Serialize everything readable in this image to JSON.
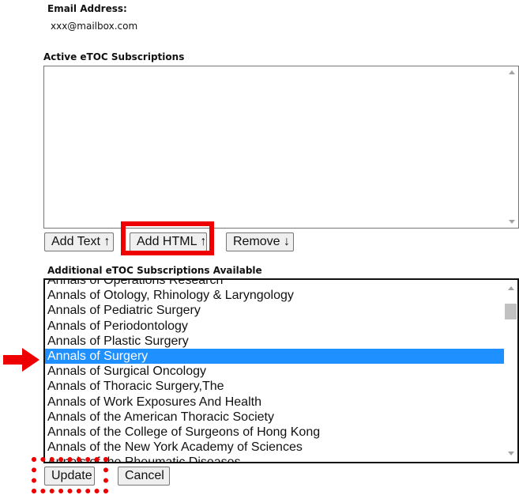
{
  "email": {
    "label": "Email Address:",
    "value": "xxx@mailbox.com"
  },
  "active": {
    "label": "Active eTOC Subscriptions",
    "items": []
  },
  "buttons": {
    "add_text": "Add Text ↑",
    "add_html": "Add HTML ↑",
    "remove": "Remove ↓",
    "update": "Update",
    "cancel": "Cancel"
  },
  "available": {
    "label": "Additional eTOC Subscriptions Available",
    "selected": "Annals of Surgery",
    "items": [
      "Annals of Operations Research",
      "Annals of Otology, Rhinology & Laryngology",
      "Annals of Pediatric Surgery",
      "Annals of Periodontology",
      "Annals of Plastic Surgery",
      "Annals of Surgery",
      "Annals of Surgical Oncology",
      "Annals of Thoracic Surgery,The",
      "Annals of Work Exposures And Health",
      "Annals of the American Thoracic Society",
      "Annals of the College of Surgeons of Hong Kong",
      "Annals of the New York Academy of Sciences",
      "Annals of the Rheumatic Diseases"
    ]
  },
  "colors": {
    "annotation": "#ee0000",
    "selection": "#1e90ff"
  },
  "icons": {
    "pointer": "right-arrow-icon",
    "scroll_up": "scroll-up-icon",
    "scroll_down": "scroll-down-icon"
  }
}
